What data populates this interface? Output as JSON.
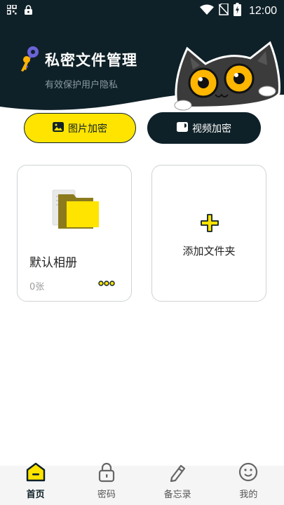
{
  "status_bar": {
    "time": "12:00",
    "icons": [
      "qr-scan-icon",
      "lock-notification-icon",
      "wifi-icon",
      "no-sim-icon",
      "battery-charging-icon"
    ]
  },
  "header": {
    "title": "私密文件管理",
    "subtitle": "有效保护用户隐私",
    "logo_icon": "keys-icon",
    "mascot": "cat-mascot"
  },
  "actions": {
    "photo_button": "图片加密",
    "video_button": "视频加密"
  },
  "albums": [
    {
      "name": "默认相册",
      "count": "0张",
      "icon": "folder-icon",
      "more_icon": "more-dots-icon"
    }
  ],
  "add_folder": {
    "label": "添加文件夹",
    "icon": "plus-icon"
  },
  "tabs": [
    {
      "label": "首页",
      "icon": "home-icon",
      "active": true
    },
    {
      "label": "密码",
      "icon": "lock-icon",
      "active": false
    },
    {
      "label": "备忘录",
      "icon": "pencil-icon",
      "active": false
    },
    {
      "label": "我的",
      "icon": "smiley-icon",
      "active": false
    }
  ],
  "colors": {
    "dark": "#0f2128",
    "accent": "#ffe400",
    "card_border": "#cfd3d5"
  }
}
